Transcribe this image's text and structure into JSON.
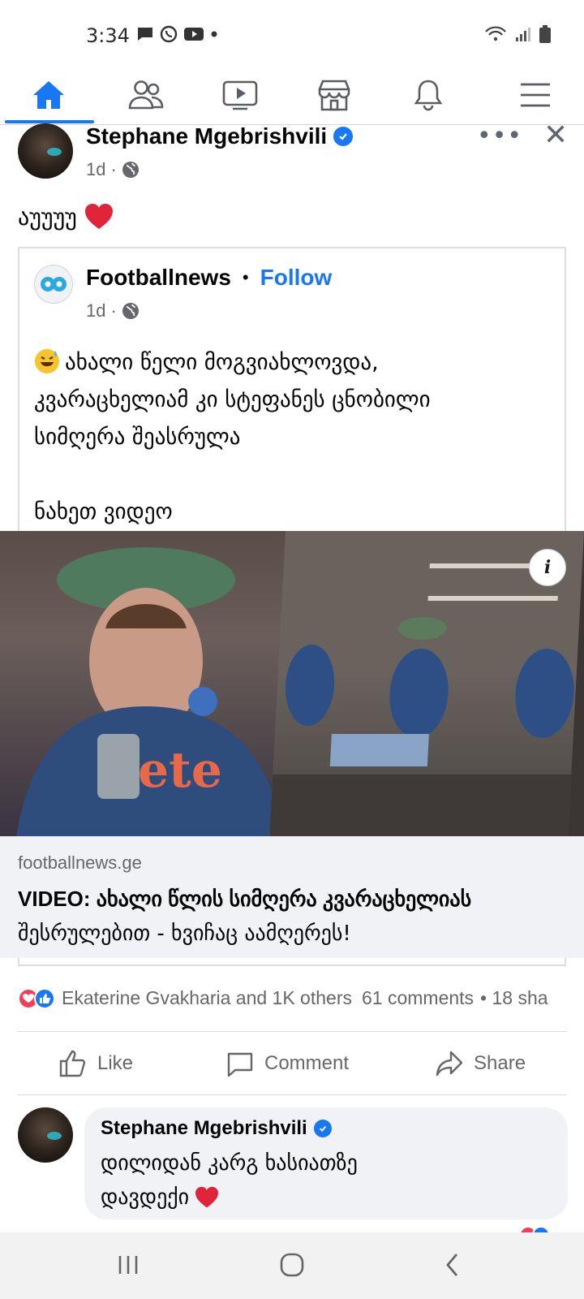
{
  "status_bar": {
    "time": "3:34"
  },
  "nav": {
    "tabs": [
      {
        "name": "home",
        "active": true
      },
      {
        "name": "friends"
      },
      {
        "name": "watch"
      },
      {
        "name": "marketplace"
      },
      {
        "name": "notifications"
      },
      {
        "name": "menu"
      }
    ],
    "accent_color": "#1877f2"
  },
  "post": {
    "author": "Stephane Mgebrishvili",
    "time": "1d",
    "text": "აუუუუ",
    "shared": {
      "author": "Footballnews",
      "follow_label": "Follow",
      "time": "1d",
      "paragraph1_line1": "ახალი წელი მოგვიახლოვდა,",
      "paragraph1_line2": "კვარაცხელიამ კი სტეფანეს ცნობილი",
      "paragraph1_line3": "სიმღერა შეასრულა",
      "paragraph2": "ნახეთ ვიდეო",
      "link_domain": "footballnews.ge",
      "link_title_line1": "VIDEO: ახალი წლის სიმღერა კვარაცხელიას",
      "link_title_line2": "შესრულებით - ხვიჩაც აამღერეს!"
    },
    "reactions_text": "Ekaterine Gvakharia and 1K others",
    "comments_text": "61 comments",
    "shares_text": "• 18 sha",
    "actions": {
      "like": "Like",
      "comment": "Comment",
      "share": "Share"
    }
  },
  "comment": {
    "author": "Stephane Mgebrishvili",
    "line1": "დილიდან კარგ ხასიათზე",
    "line2": "დავდექი"
  }
}
